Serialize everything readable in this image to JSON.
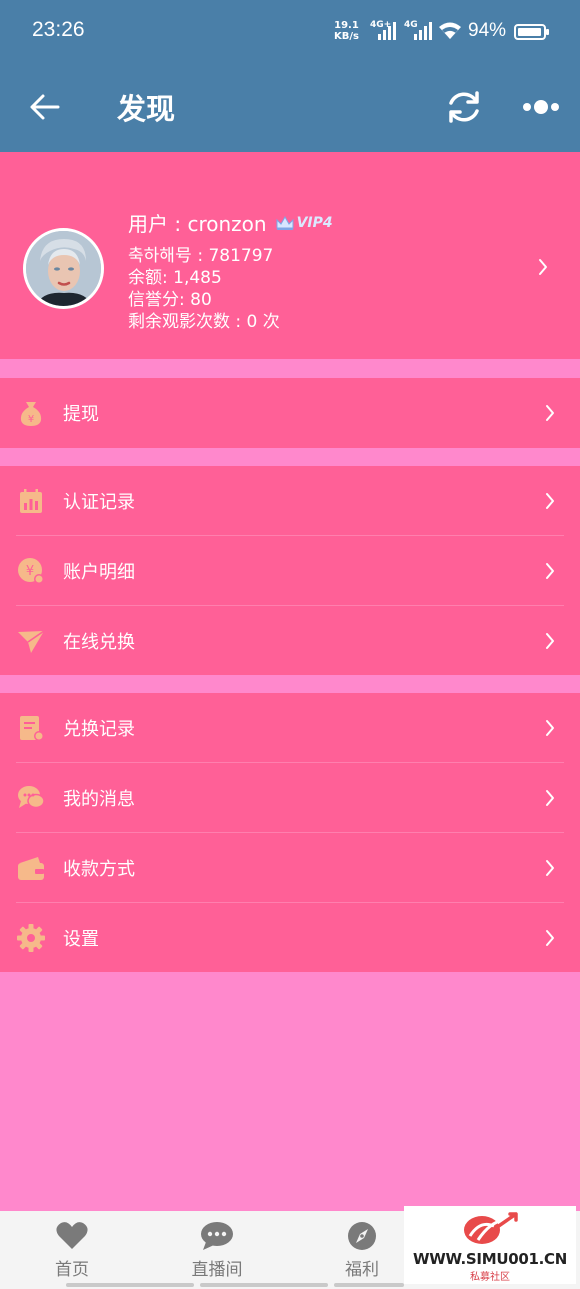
{
  "status_bar": {
    "time": "23:26",
    "net_speed_value": "19.1",
    "net_speed_unit": "KB/s",
    "sim1_label": "4G+",
    "sim2_label": "4G",
    "battery_percent": "94%"
  },
  "app_bar": {
    "title": "发现",
    "back_icon": "arrow-left-icon",
    "refresh_icon": "refresh-icon",
    "more_icon": "more-dots-icon"
  },
  "profile": {
    "username": "用户 : cronzon",
    "vip_label": "VIP4",
    "account_id": "축하해号 : 781797",
    "balance": "余额: 1,485",
    "credit": "信誉分: 80",
    "remaining_views": "剩余观影次数 : 0 次"
  },
  "menu_groups": [
    {
      "items": [
        {
          "label": "提现",
          "icon": "money-bag-icon"
        }
      ]
    },
    {
      "items": [
        {
          "label": "认证记录",
          "icon": "calendar-chart-icon"
        },
        {
          "label": "账户明细",
          "icon": "coin-icon"
        },
        {
          "label": "在线兑换",
          "icon": "paper-plane-icon"
        }
      ]
    },
    {
      "items": [
        {
          "label": "兑换记录",
          "icon": "document-icon"
        },
        {
          "label": "我的消息",
          "icon": "chat-bubbles-icon"
        },
        {
          "label": "收款方式",
          "icon": "wallet-icon"
        },
        {
          "label": "设置",
          "icon": "gear-icon"
        }
      ]
    }
  ],
  "bottom_nav": [
    {
      "label": "首页",
      "icon": "heart-icon"
    },
    {
      "label": "直播间",
      "icon": "chat-dots-icon"
    },
    {
      "label": "福利",
      "icon": "compass-icon"
    }
  ],
  "watermark": {
    "text": "WWW.SIMU001.CN",
    "subtext": "私募社区"
  },
  "colors": {
    "header": "#4a7fa8",
    "panel": "#ff6097",
    "background": "#ff88cc",
    "icon_accent": "#f6b98a"
  }
}
